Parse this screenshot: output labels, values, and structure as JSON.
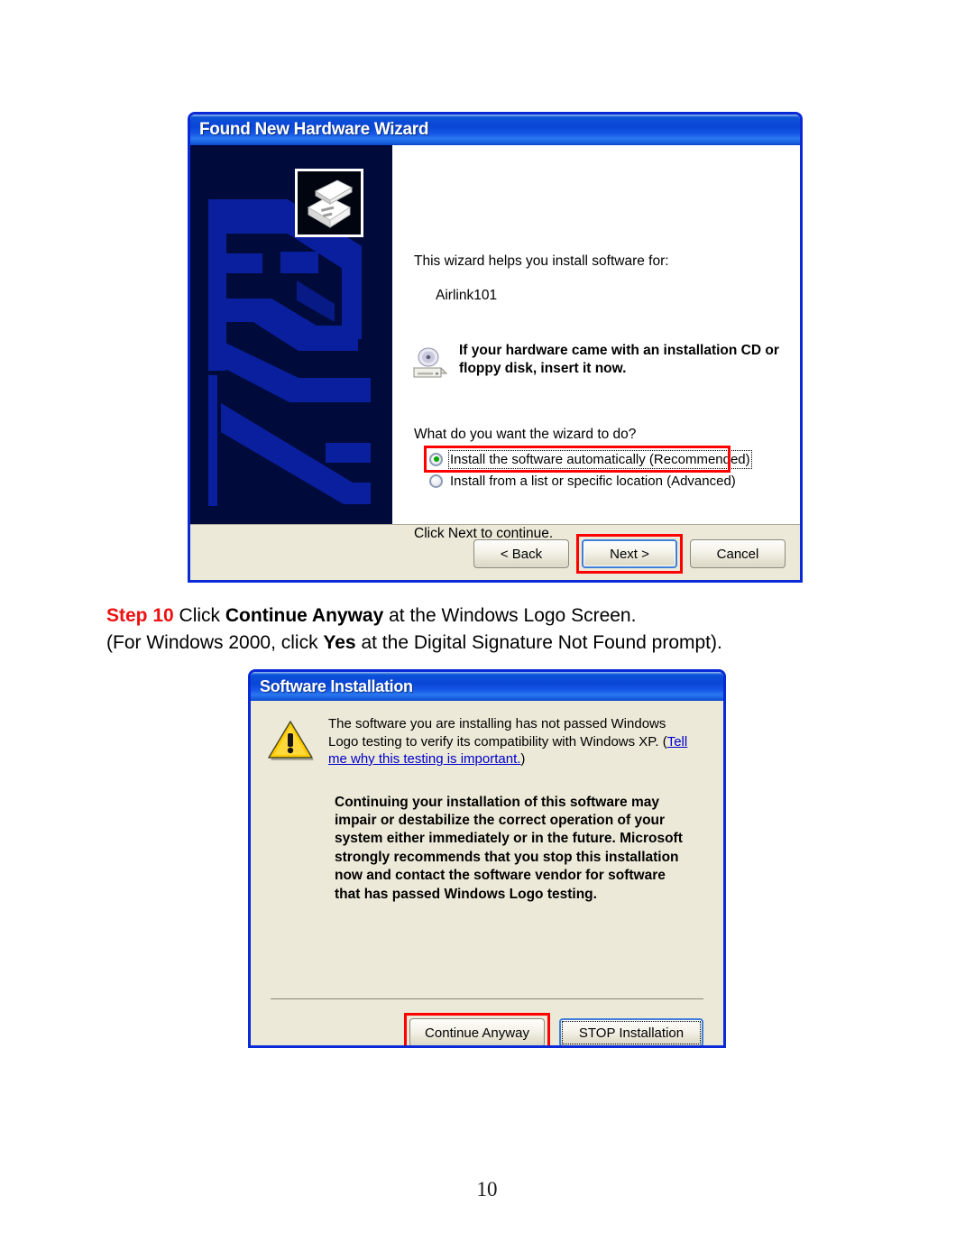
{
  "page": {
    "number": "10"
  },
  "wizard": {
    "title": "Found New Hardware Wizard",
    "icon": "add-hardware-icon",
    "intro_line": "This wizard helps you install software for:",
    "device_name": "Airlink101",
    "cd_icon": "cd-drive-icon",
    "cd_notice": "If your hardware came with an installation CD or floppy disk, insert it now.",
    "question": "What do you want the wizard to do?",
    "options": [
      {
        "label": "Install the software automatically (Recommended)",
        "selected": true,
        "highlighted": true
      },
      {
        "label": "Install from a list or specific location (Advanced)",
        "selected": false,
        "highlighted": false
      }
    ],
    "continue_hint": "Click Next to continue.",
    "buttons": {
      "back": "< Back",
      "next": "Next >",
      "cancel": "Cancel"
    },
    "highlight_color": "#ff0000",
    "titlebar_color": "#0b4fd8",
    "sidebar_color": "#000b3c"
  },
  "step": {
    "tag": "Step 10",
    "line1_pre": " Click ",
    "line1_strong": "Continue Anyway",
    "line1_post": " at the Windows Logo Screen.",
    "line2_pre": "(For Windows 2000, click ",
    "line2_strong": "Yes",
    "line2_post": " at the Digital Signature Not Found prompt).",
    "tag_color": "#ee1111"
  },
  "software_installation": {
    "title": "Software Installation",
    "warning_icon": "warning-triangle-icon",
    "paragraph1_pre": "The software you are installing has not passed Windows Logo testing to verify its compatibility with Windows XP. (",
    "paragraph1_link": "Tell me why this testing is important.",
    "paragraph1_post": ")",
    "paragraph2": "Continuing your installation of this software may impair or destabilize the correct operation of your system either immediately or in the future. Microsoft strongly recommends that you stop this installation now and contact the software vendor for software that has passed Windows Logo testing.",
    "buttons": {
      "continue": "Continue Anyway",
      "stop": "STOP Installation"
    },
    "highlight_color": "#ff0000",
    "link_color": "#0000cc"
  }
}
